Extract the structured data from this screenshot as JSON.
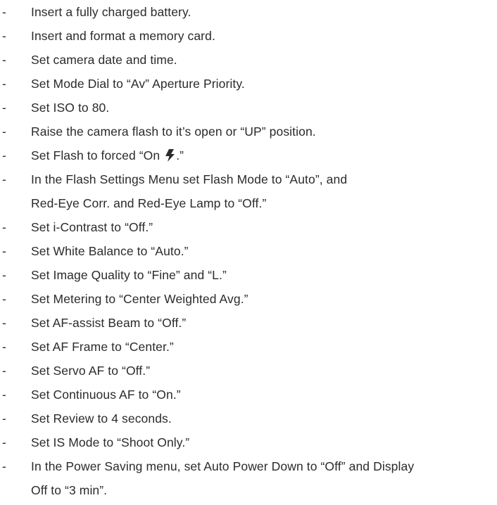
{
  "checklist": {
    "items": [
      "Insert a fully charged battery.",
      "Insert and format a memory card.",
      "Set camera date and time.",
      "Set Mode Dial to “Av” Aperture Priority.",
      "Set ISO to 80.",
      "Raise the camera flash to it’s open or “UP” position.",
      {
        "before": "Set Flash to forced “On ",
        "icon": "flash-bolt-icon",
        "after": ".”"
      },
      [
        "In the Flash Settings Menu set Flash Mode to “Auto”, and",
        "Red-Eye Corr. and Red-Eye Lamp to “Off.”"
      ],
      "Set i-Contrast to “Off.”",
      "Set White Balance to “Auto.”",
      "Set Image Quality to “Fine” and  “L.”",
      "Set Metering to “Center Weighted Avg.”",
      "Set AF-assist Beam to “Off.”",
      "Set AF Frame to “Center.”",
      "Set Servo AF to “Off.”",
      "Set Continuous AF to “On.”",
      "Set Review to 4 seconds.",
      "Set IS Mode to “Shoot Only.”",
      [
        "In the Power Saving menu, set Auto Power Down to “Off” and Display",
        "Off to “3 min”."
      ]
    ],
    "bullet": "-"
  }
}
